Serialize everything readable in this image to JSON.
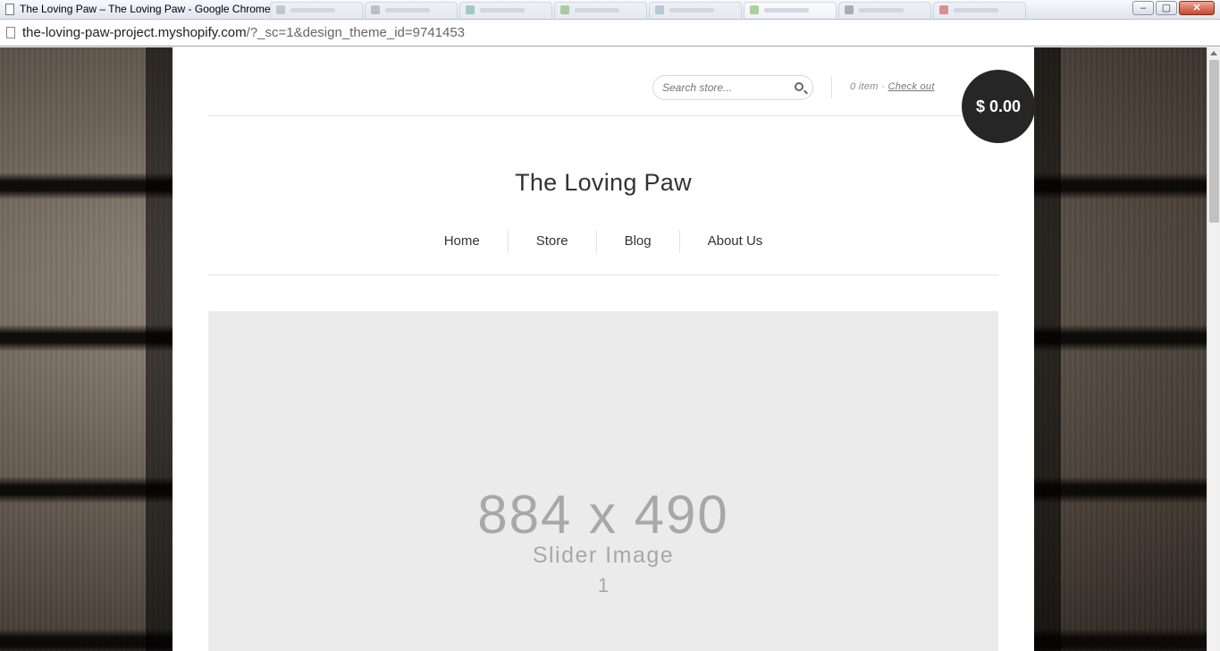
{
  "window": {
    "title": "The Loving Paw – The Loving Paw - Google Chrome",
    "tab_count": 8,
    "controls": {
      "minimize": "–",
      "maximize": "▢",
      "close": "✕"
    }
  },
  "address": {
    "host": "the-loving-paw-project.myshopify.com",
    "path": "/?_sc=1&design_theme_id=9741453"
  },
  "store": {
    "search_placeholder": "Search store...",
    "cart_count": "0 item",
    "cart_separator": "·",
    "checkout_label": "Check out",
    "cart_total": "$ 0.00",
    "title": "The Loving Paw"
  },
  "nav": {
    "items": [
      "Home",
      "Store",
      "Blog",
      "About Us"
    ]
  },
  "slider": {
    "dimensions": "884 x 490",
    "label": "Slider Image",
    "index": "1"
  },
  "colors": {
    "cart_circle": "#262626",
    "placeholder_bg": "#ebebeb",
    "placeholder_text": "#a8a8a8"
  }
}
